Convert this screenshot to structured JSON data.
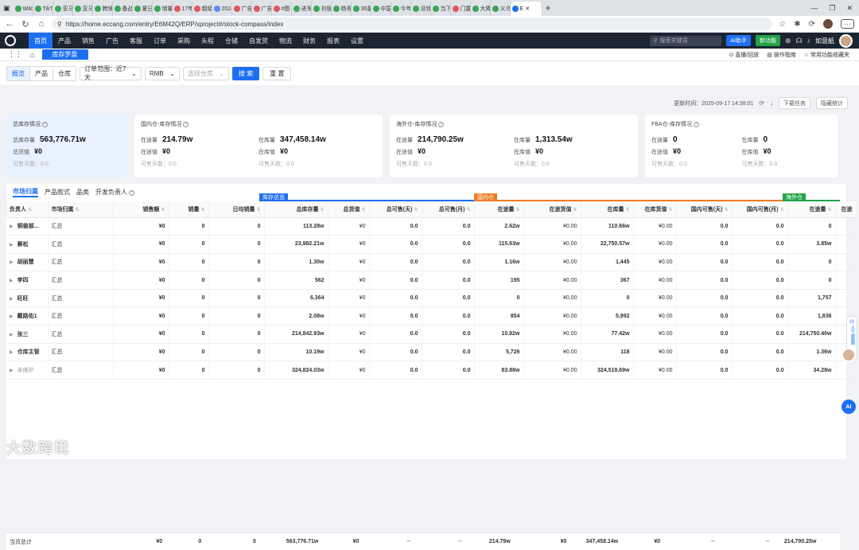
{
  "browser": {
    "tabs": [
      {
        "label": "Wild",
        "color": "#3aa655"
      },
      {
        "label": "TikTo",
        "color": "#3aa655"
      },
      {
        "label": "亚马",
        "color": "#3aa655"
      },
      {
        "label": "亚马",
        "color": "#3aa655"
      },
      {
        "label": "跨境",
        "color": "#3aa655"
      },
      {
        "label": "备战",
        "color": "#3aa655"
      },
      {
        "label": "夏日",
        "color": "#3aa655"
      },
      {
        "label": "增量",
        "color": "#3aa655"
      },
      {
        "label": "17年",
        "color": "#e0565b"
      },
      {
        "label": "超级",
        "color": "#e0565b"
      },
      {
        "label": "2024",
        "color": "#5b8def"
      },
      {
        "label": "广告",
        "color": "#e0565b"
      },
      {
        "label": "广告",
        "color": "#e0565b"
      },
      {
        "label": "#图",
        "color": "#e0565b"
      },
      {
        "label": "进军",
        "color": "#3aa655"
      },
      {
        "label": "刘强",
        "color": "#3aa655"
      },
      {
        "label": "杨哥",
        "color": "#3aa655"
      },
      {
        "label": "36氪",
        "color": "#3aa655"
      },
      {
        "label": "中国",
        "color": "#3aa655"
      },
      {
        "label": "今年",
        "color": "#3aa655"
      },
      {
        "label": "没钱",
        "color": "#3aa655"
      },
      {
        "label": "当下",
        "color": "#3aa655"
      },
      {
        "label": "门露",
        "color": "#e0565b"
      },
      {
        "label": "大降",
        "color": "#3aa655"
      },
      {
        "label": "义乌",
        "color": "#3aa655"
      }
    ],
    "active_tab": {
      "label": "E",
      "color": "#1d6ff2"
    },
    "url": "https://home.eccang.com/entry/E6M42Q/ERP/xproject#/stock-compass/index"
  },
  "nav": {
    "menu": [
      "首页",
      "产品",
      "销售",
      "广告",
      "客服",
      "订单",
      "采购",
      "头程",
      "仓储",
      "自发货",
      "物流",
      "财务",
      "报表",
      "设置"
    ],
    "search_placeholder": "搜索关键词",
    "ai_label": "AI助手",
    "new_label": "新功能",
    "user": "如意紙"
  },
  "subtab": {
    "label": "库存罗盘",
    "links": [
      "直播/回放",
      "操作指南",
      "常用功能收藏夹"
    ]
  },
  "filters": {
    "segments": [
      "概览",
      "产品",
      "仓库"
    ],
    "order_range": "订单范围：近7天",
    "currency": "RMB",
    "warehouse_placeholder": "选择仓库",
    "search_label": "搜 索",
    "reset_label": "重 置"
  },
  "update": {
    "text": "更新时间：2025-09-17 14:38:01",
    "download": "下载任务",
    "hide": "隐藏统计"
  },
  "cards": [
    {
      "title": "总库存情况",
      "rows": [
        {
          "k": "总库存量",
          "v": "563,776.71w"
        },
        {
          "k": "总货值",
          "v": "¥0"
        }
      ],
      "sub": "可售天数：0.0"
    },
    {
      "title": "国内仓-库存情况",
      "left": [
        {
          "k": "在途量",
          "v": "214.79w"
        },
        {
          "k": "在途值",
          "v": "¥0"
        }
      ],
      "right": [
        {
          "k": "在库量",
          "v": "347,458.14w"
        },
        {
          "k": "在库值",
          "v": "¥0"
        }
      ],
      "sub_l": "可售天数：0.0",
      "sub_r": "可售天数：0.0"
    },
    {
      "title": "海外仓-库存情况",
      "left": [
        {
          "k": "在途量",
          "v": "214,790.25w"
        },
        {
          "k": "在途值",
          "v": "¥0"
        }
      ],
      "right": [
        {
          "k": "在库量",
          "v": "1,313.54w"
        },
        {
          "k": "在库值",
          "v": "¥0"
        }
      ],
      "sub_l": "可售天数：0.0",
      "sub_r": "可售天数：0.0"
    },
    {
      "title": "FBA仓-库存情况",
      "left": [
        {
          "k": "在途量",
          "v": "0"
        },
        {
          "k": "在途值",
          "v": "¥0"
        }
      ],
      "right": [
        {
          "k": "在库量",
          "v": "0"
        },
        {
          "k": "在库值",
          "v": "¥0"
        }
      ],
      "sub_l": "可售天数：0.0",
      "sub_r": "可售天数：0.0"
    }
  ],
  "table": {
    "tabs": [
      "市场归属",
      "产品款式",
      "品类",
      "开发负责人"
    ],
    "groups": [
      {
        "label": "库存总览",
        "color": "#1d6ff2"
      },
      {
        "label": "国内仓",
        "color": "#f07b22"
      },
      {
        "label": "海外仓",
        "color": "#22a34a"
      }
    ],
    "headers": [
      "负责人",
      "市场归属",
      "销售额",
      "销量",
      "日均销量",
      "总库存量",
      "总货值",
      "总可售(天)",
      "总可售(月)",
      "在途量",
      "在途货值",
      "在库量",
      "在库货值",
      "国内可售(天)",
      "国内可售(月)",
      "在途量",
      "在途"
    ],
    "rows": [
      [
        "铜兽部...",
        "汇总",
        "¥0",
        "0",
        "0",
        "113.28w",
        "¥0",
        "0.0",
        "0.0",
        "2.62w",
        "¥0.00",
        "110.66w",
        "¥0.00",
        "0.0",
        "0.0",
        "0",
        ""
      ],
      [
        "蔡松",
        "汇总",
        "¥0",
        "0",
        "0",
        "23,982.21w",
        "¥0",
        "0.0",
        "0.0",
        "115.63w",
        "¥0.00",
        "22,750.57w",
        "¥0.00",
        "0.0",
        "0.0",
        "3.85w",
        ""
      ],
      [
        "胡丽慧",
        "汇总",
        "¥0",
        "0",
        "0",
        "1.30w",
        "¥0",
        "0.0",
        "0.0",
        "1.16w",
        "¥0.00",
        "1,445",
        "¥0.00",
        "0.0",
        "0.0",
        "0",
        ""
      ],
      [
        "李四",
        "汇总",
        "¥0",
        "0",
        "0",
        "562",
        "¥0",
        "0.0",
        "0.0",
        "195",
        "¥0.00",
        "367",
        "¥0.00",
        "0.0",
        "0.0",
        "0",
        ""
      ],
      [
        "旺旺",
        "汇总",
        "¥0",
        "0",
        "0",
        "6,364",
        "¥0",
        "0.0",
        "0.0",
        "0",
        "¥0.00",
        "0",
        "¥0.00",
        "0.0",
        "0.0",
        "1,757",
        ""
      ],
      [
        "戴路佑1",
        "汇总",
        "¥0",
        "0",
        "0",
        "2.08w",
        "¥0",
        "0.0",
        "0.0",
        "854",
        "¥0.00",
        "5,992",
        "¥0.00",
        "0.0",
        "0.0",
        "1,836",
        ""
      ],
      [
        "张三",
        "汇总",
        "¥0",
        "0",
        "0",
        "214,842.93w",
        "¥0",
        "0.0",
        "0.0",
        "10.82w",
        "¥0.00",
        "77.42w",
        "¥0.00",
        "0.0",
        "0.0",
        "214,750.40w",
        ""
      ],
      [
        "仓库主管",
        "汇总",
        "¥0",
        "0",
        "0",
        "10.19w",
        "¥0",
        "0.0",
        "0.0",
        "5,726",
        "¥0.00",
        "118",
        "¥0.00",
        "0.0",
        "0.0",
        "1.36w",
        ""
      ],
      [
        "未维护",
        "汇总",
        "¥0",
        "0",
        "0",
        "324,824.03w",
        "¥0",
        "0.0",
        "0.0",
        "83.88w",
        "¥0.00",
        "324,518.69w",
        "¥0.00",
        "0.0",
        "0.0",
        "34.28w",
        ""
      ]
    ],
    "total": [
      "当页总计",
      "",
      "¥0",
      "0",
      "0",
      "563,776.71w",
      "¥0",
      "--",
      "--",
      "214.79w",
      "¥0",
      "347,458.14w",
      "¥0",
      "--",
      "--",
      "214,790.25w",
      ""
    ]
  },
  "side": {
    "service": "人工客服",
    "ai": "AI"
  },
  "watermark": "大数跨境"
}
